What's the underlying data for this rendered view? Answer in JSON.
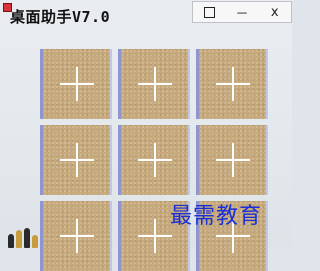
{
  "window": {
    "title": "桌面助手V7.0",
    "controls": {
      "maximize": "口",
      "minimize": "－",
      "close": "x"
    }
  },
  "grid": {
    "tiles": [
      {
        "label": "add-slot"
      },
      {
        "label": "add-slot"
      },
      {
        "label": "add-slot"
      },
      {
        "label": "add-slot"
      },
      {
        "label": "add-slot"
      },
      {
        "label": "add-slot"
      },
      {
        "label": "add-slot"
      },
      {
        "label": "add-slot"
      },
      {
        "label": "add-slot"
      }
    ]
  },
  "watermark": {
    "text": "最需教育"
  },
  "colors": {
    "tile": "#c6aa7c",
    "tile_edge": "#8f95cf",
    "watermark": "#1a2fd6"
  }
}
